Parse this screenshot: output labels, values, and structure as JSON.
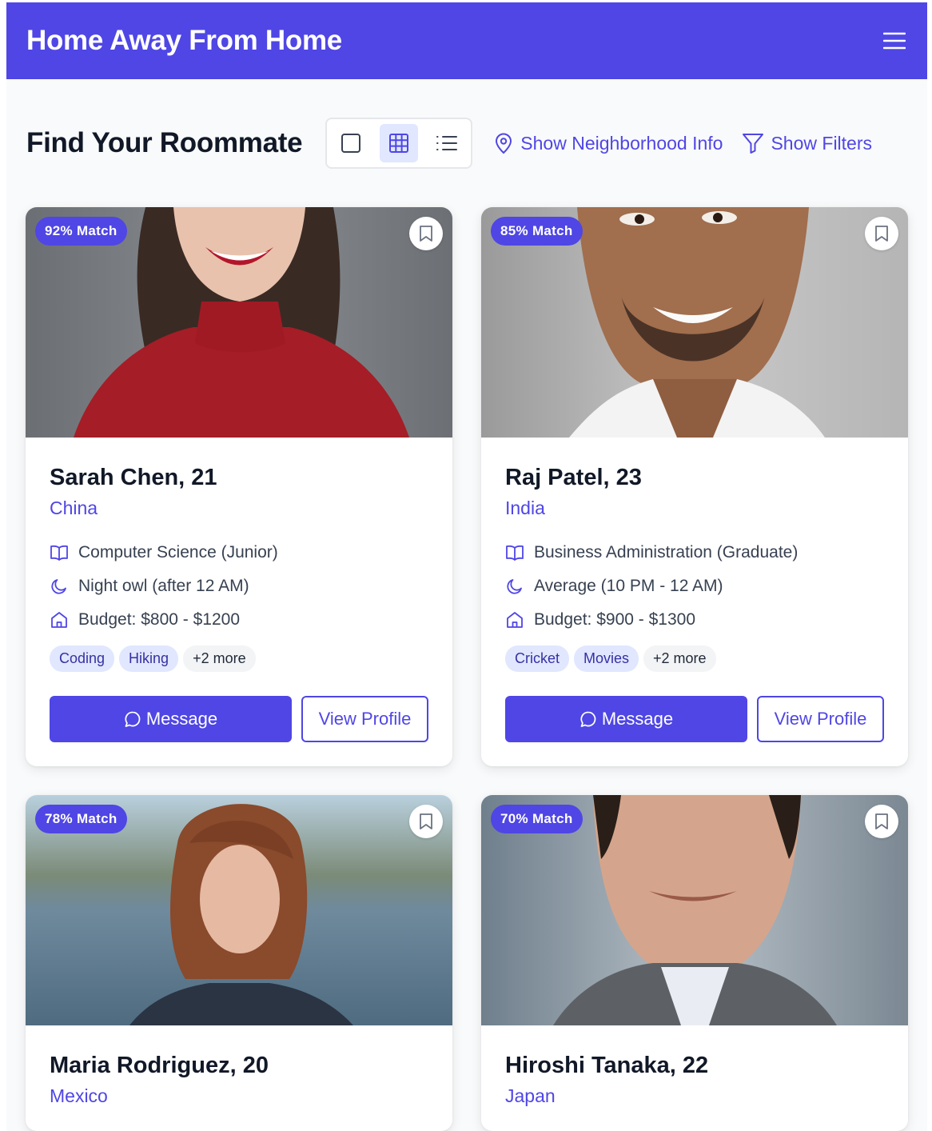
{
  "header": {
    "app_title": "Home Away From Home",
    "menu_icon": "hamburger-menu-icon"
  },
  "toolbar": {
    "page_title": "Find Your Roommate",
    "views": [
      {
        "icon": "single-view-icon",
        "active": false
      },
      {
        "icon": "grid-view-icon",
        "active": true
      },
      {
        "icon": "list-view-icon",
        "active": false
      }
    ],
    "neighborhood_label": "Show Neighborhood Info",
    "filters_label": "Show Filters"
  },
  "colors": {
    "accent": "#4f46e5",
    "tag_bg": "#e0e7ff",
    "tag_text": "#3730a3"
  },
  "cards": [
    {
      "match": "92% Match",
      "name": "Sarah Chen, 21",
      "country": "China",
      "major": "Computer Science (Junior)",
      "sleep": "Night owl (after 12 AM)",
      "budget": "Budget: $800 - $1200",
      "tags": [
        "Coding",
        "Hiking"
      ],
      "more": "+2 more",
      "message_label": "Message",
      "profile_label": "View Profile"
    },
    {
      "match": "85% Match",
      "name": "Raj Patel, 23",
      "country": "India",
      "major": "Business Administration (Graduate)",
      "sleep": "Average (10 PM - 12 AM)",
      "budget": "Budget: $900 - $1300",
      "tags": [
        "Cricket",
        "Movies"
      ],
      "more": "+2 more",
      "message_label": "Message",
      "profile_label": "View Profile"
    },
    {
      "match": "78% Match",
      "name": "Maria Rodriguez, 20",
      "country": "Mexico"
    },
    {
      "match": "70% Match",
      "name": "Hiroshi Tanaka, 22",
      "country": "Japan"
    }
  ]
}
